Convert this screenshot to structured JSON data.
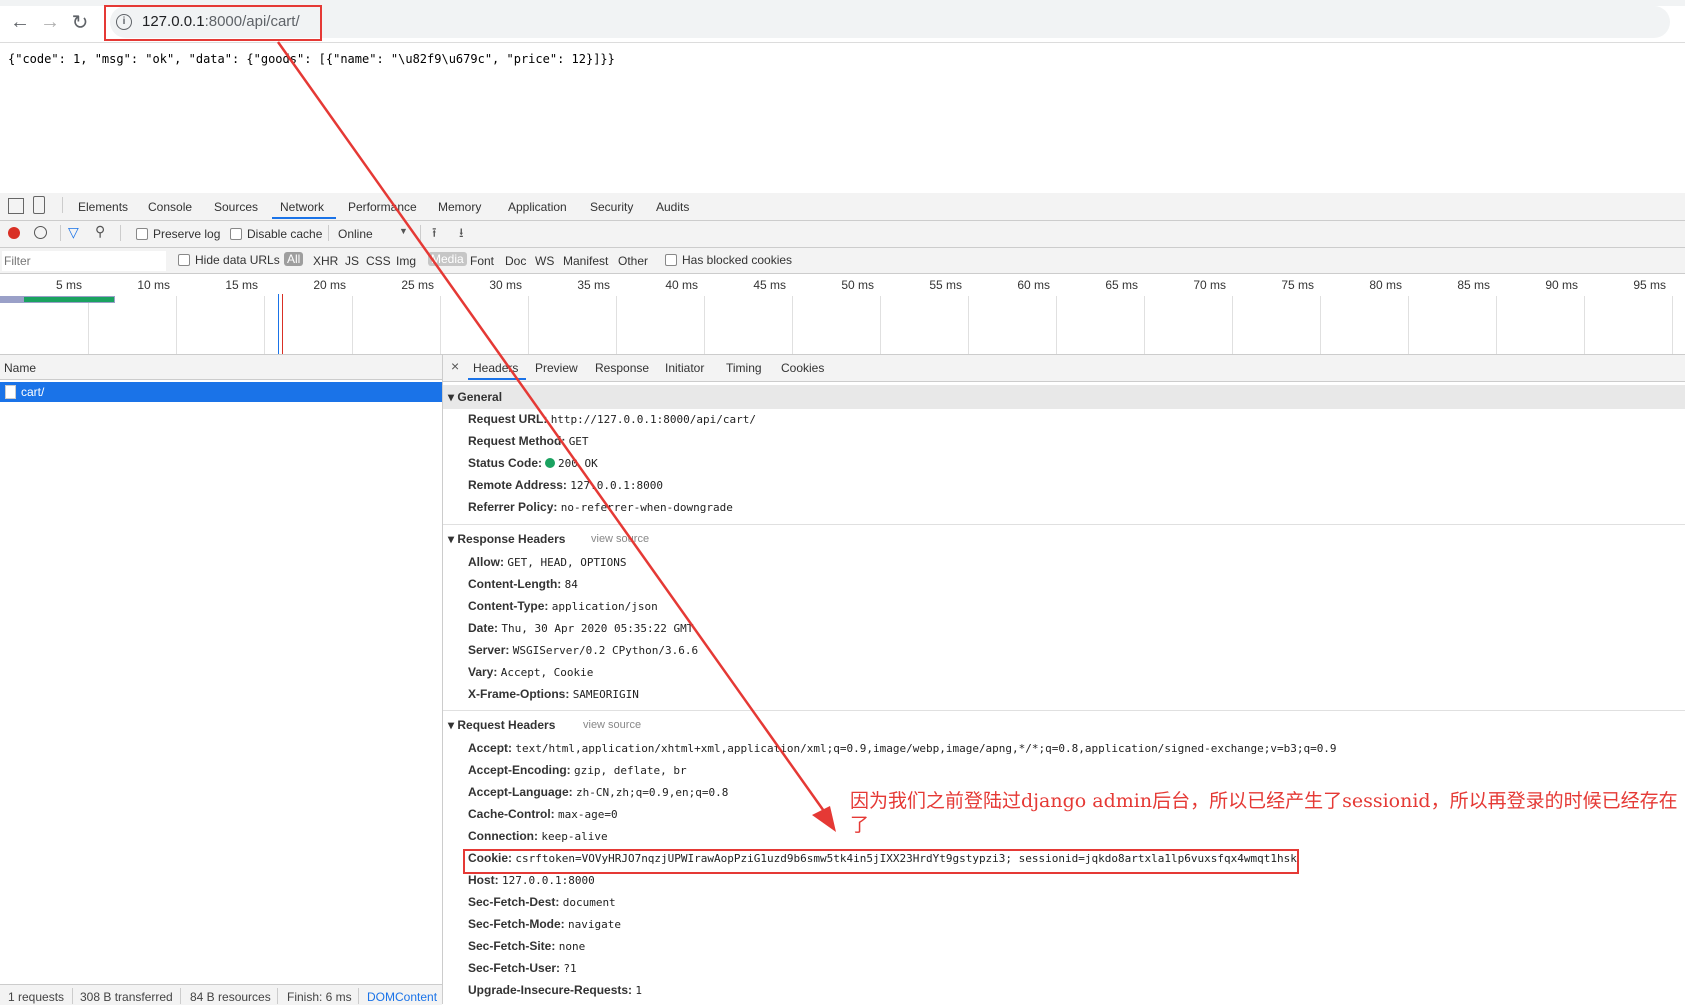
{
  "browser": {
    "url_host": "127.0.0.1",
    "url_rest": ":8000/api/cart/",
    "back_icon": "arrow-left-icon",
    "forward_icon": "arrow-right-icon",
    "reload_icon": "reload-icon"
  },
  "response_body": "{\"code\": 1, \"msg\": \"ok\", \"data\": {\"goods\": [{\"name\": \"\\u82f9\\u679c\", \"price\": 12}]}}",
  "devtools": {
    "tabs": [
      "Elements",
      "Console",
      "Sources",
      "Network",
      "Performance",
      "Memory",
      "Application",
      "Security",
      "Audits"
    ],
    "active_tab": "Network",
    "toolbar": {
      "preserve_log": "Preserve log",
      "disable_cache": "Disable cache",
      "throttle": "Online"
    },
    "filter": {
      "placeholder": "Filter",
      "hide_data_urls": "Hide data URLs",
      "types": [
        "All",
        "XHR",
        "JS",
        "CSS",
        "Img",
        "Media",
        "Font",
        "Doc",
        "WS",
        "Manifest",
        "Other"
      ],
      "has_blocked_cookies": "Has blocked cookies"
    },
    "timeline_ticks": [
      "5 ms",
      "10 ms",
      "15 ms",
      "20 ms",
      "25 ms",
      "30 ms",
      "35 ms",
      "40 ms",
      "45 ms",
      "50 ms",
      "55 ms",
      "60 ms",
      "65 ms",
      "70 ms",
      "75 ms",
      "80 ms",
      "85 ms",
      "90 ms",
      "95 ms"
    ],
    "requests": {
      "column_name": "Name",
      "rows": [
        "cart/"
      ]
    },
    "status_bar": {
      "requests": "1 requests",
      "transferred": "308 B transferred",
      "resources": "84 B resources",
      "finish": "Finish: 6 ms",
      "dom": "DOMContent"
    },
    "detail_tabs": [
      "Headers",
      "Preview",
      "Response",
      "Initiator",
      "Timing",
      "Cookies"
    ],
    "general": {
      "title": "General",
      "rows": [
        {
          "k": "Request URL:",
          "v": "http://127.0.0.1:8000/api/cart/"
        },
        {
          "k": "Request Method:",
          "v": "GET"
        },
        {
          "k": "Status Code:",
          "v": "200 OK"
        },
        {
          "k": "Remote Address:",
          "v": "127.0.0.1:8000"
        },
        {
          "k": "Referrer Policy:",
          "v": "no-referrer-when-downgrade"
        }
      ]
    },
    "response_headers": {
      "title": "Response Headers",
      "view_source": "view source",
      "rows": [
        {
          "k": "Allow:",
          "v": "GET, HEAD, OPTIONS"
        },
        {
          "k": "Content-Length:",
          "v": "84"
        },
        {
          "k": "Content-Type:",
          "v": "application/json"
        },
        {
          "k": "Date:",
          "v": "Thu, 30 Apr 2020 05:35:22 GMT"
        },
        {
          "k": "Server:",
          "v": "WSGIServer/0.2 CPython/3.6.6"
        },
        {
          "k": "Vary:",
          "v": "Accept, Cookie"
        },
        {
          "k": "X-Frame-Options:",
          "v": "SAMEORIGIN"
        }
      ]
    },
    "request_headers": {
      "title": "Request Headers",
      "view_source": "view source",
      "rows": [
        {
          "k": "Accept:",
          "v": "text/html,application/xhtml+xml,application/xml;q=0.9,image/webp,image/apng,*/*;q=0.8,application/signed-exchange;v=b3;q=0.9"
        },
        {
          "k": "Accept-Encoding:",
          "v": "gzip, deflate, br"
        },
        {
          "k": "Accept-Language:",
          "v": "zh-CN,zh;q=0.9,en;q=0.8"
        },
        {
          "k": "Cache-Control:",
          "v": "max-age=0"
        },
        {
          "k": "Connection:",
          "v": "keep-alive"
        },
        {
          "k": "Cookie:",
          "v": "csrftoken=VOVyHRJO7nqzjUPWIrawAopPziG1uzd9b6smw5tk4in5jIXX23HrdYt9gstypzi3; sessionid=jqkdo8artxla1lp6vuxsfqx4wmqt1hsk"
        },
        {
          "k": "Host:",
          "v": "127.0.0.1:8000"
        },
        {
          "k": "Sec-Fetch-Dest:",
          "v": "document"
        },
        {
          "k": "Sec-Fetch-Mode:",
          "v": "navigate"
        },
        {
          "k": "Sec-Fetch-Site:",
          "v": "none"
        },
        {
          "k": "Sec-Fetch-User:",
          "v": "?1"
        },
        {
          "k": "Upgrade-Insecure-Requests:",
          "v": "1"
        }
      ]
    }
  },
  "annotation": {
    "text": "因为我们之前登陆过django admin后台，所以已经产生了sessionid，所以再登录的时候已经存在了",
    "color": "#e53935"
  }
}
